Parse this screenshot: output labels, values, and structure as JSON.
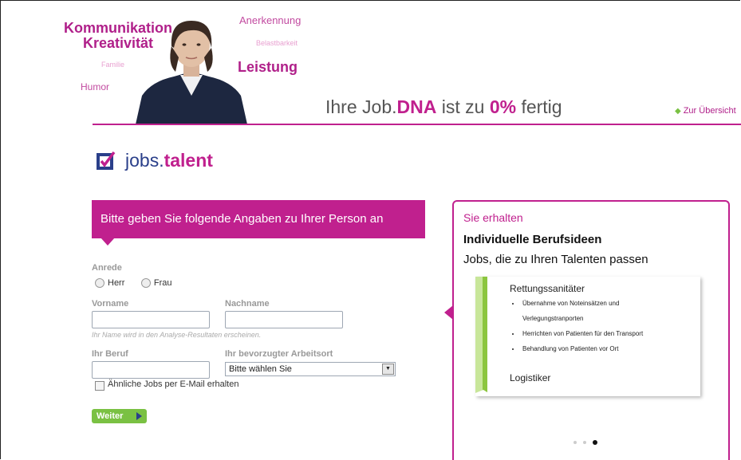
{
  "header": {
    "words": {
      "kommunikation": "Kommunikation",
      "kreativitaet": "Kreativität",
      "familie": "Familie",
      "humor": "Humor",
      "anerkennung": "Anerkennung",
      "belastbarkeit": "Belastbarkeit",
      "leistung": "Leistung"
    },
    "dna": {
      "prefix": "Ihre Job.",
      "dna": "DNA",
      "middle": " ist zu ",
      "percent": "0%",
      "suffix": " fertig"
    },
    "overview_link": "Zur Übersicht"
  },
  "logo": {
    "jobs": "jobs.",
    "talent": "talent"
  },
  "form": {
    "banner": "Bitte geben Sie folgende Angaben zu Ihrer Person an",
    "anrede_label": "Anrede",
    "radio_herr": "Herr",
    "radio_frau": "Frau",
    "vorname_label": "Vorname",
    "vorname_value": "",
    "nachname_label": "Nachname",
    "nachname_value": "",
    "name_hint": "Ihr Name wird in den Analyse-Resultaten erscheinen.",
    "beruf_label": "Ihr Beruf",
    "beruf_value": "",
    "arbeitsort_label": "Ihr bevorzugter Arbeitsort",
    "arbeitsort_selected": "Bitte wählen Sie",
    "checkbox_label": "Ähnliche Jobs per E-Mail erhalten",
    "weiter": "Weiter"
  },
  "panel": {
    "heading": "Sie erhalten",
    "title": "Individuelle Berufsideen",
    "subtitle": "Jobs, die zu Ihren Talenten passen",
    "card": {
      "job1": "Rettungssanitäter",
      "bullets": [
        "Übernahme von Noteinsätzen und Verlegungstranporten",
        "Herrichten von Patienten für den Transport",
        "Behandlung von Patienten vor Ort"
      ],
      "job2": "Logistiker"
    },
    "carousel": {
      "count": 3,
      "active": 3
    }
  },
  "colors": {
    "accent": "#c0208e",
    "green": "#7ac143",
    "navy": "#2a3f8a"
  }
}
